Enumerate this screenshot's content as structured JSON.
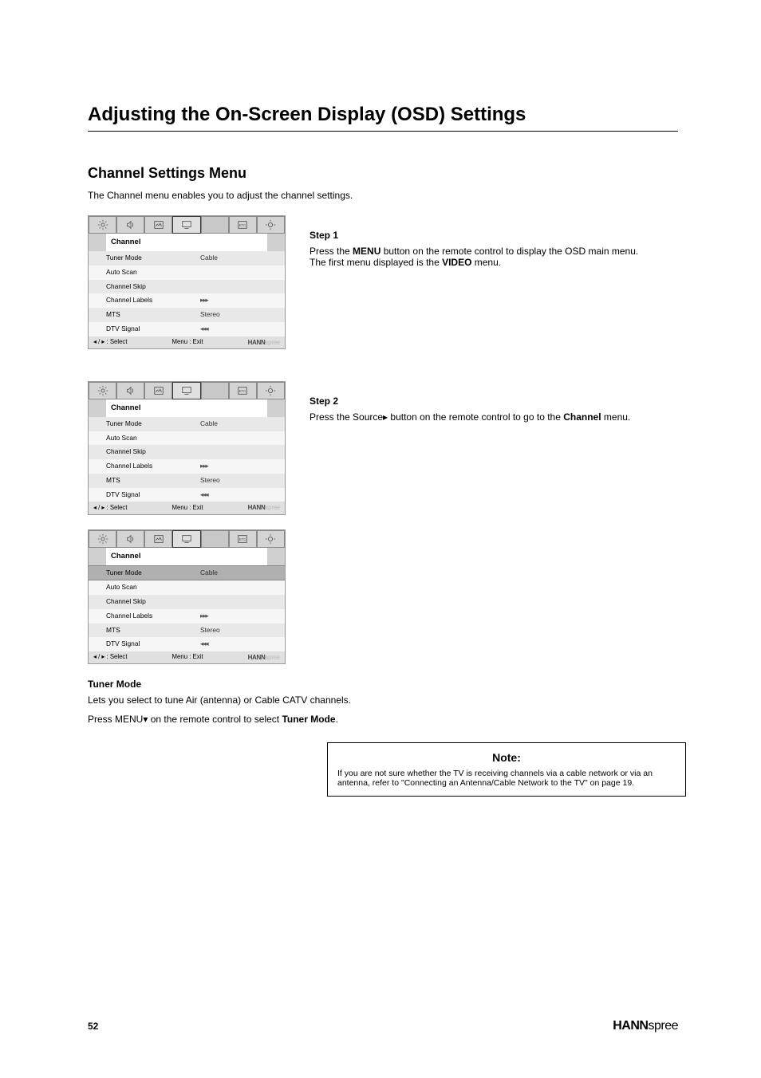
{
  "title": "Adjusting the On-Screen Display (OSD) Settings",
  "section_heading": "Channel Settings Menu",
  "intro": "The Channel menu enables you to adjust the channel settings.",
  "category_label": "Channel",
  "osd_items": [
    {
      "label": "Tuner Mode",
      "value": "Cable"
    },
    {
      "label": "Auto Scan",
      "value": ""
    },
    {
      "label": "Channel Skip",
      "value": ""
    },
    {
      "label": "Channel Labels",
      "value": "",
      "arrow": "r"
    },
    {
      "label": "MTS",
      "value": "Stereo"
    },
    {
      "label": "DTV Signal",
      "value": "",
      "arrow": "l"
    }
  ],
  "osd_footer_left": "◂ / ▸  : Select",
  "osd_footer_right": "Menu : Exit",
  "osd_brand": {
    "bold": "HANN",
    "lite": "spree"
  },
  "step1": {
    "label": "Step 1",
    "text_a": "Press the ",
    "menu_btn": "MENU",
    "text_b": " button on the remote control to display the OSD main menu. The first menu displayed is the ",
    "video_word": "VIDEO",
    "text_c": " menu."
  },
  "step2": {
    "label": "Step 2",
    "text_a": "Press the Source▸ button on the remote control to go to the ",
    "channel_word": "Channel",
    "text_b": " menu."
  },
  "tuner_mode": {
    "label": "Tuner Mode",
    "desc": "Lets you select to tune Air (antenna) or Cable CATV channels.",
    "instr_a": "Press MENU▾ on the remote control to select ",
    "instr_word": "Tuner Mode",
    "instr_b": "."
  },
  "note": {
    "title": "Note:",
    "body": "If you are not sure whether the TV is receiving channels via a cable network or via an antenna, refer to \"Connecting an Antenna/Cable Network to the TV\" on page 19."
  },
  "footer": {
    "page": "52",
    "logo_bold": "HANN",
    "logo_light": "spree"
  }
}
